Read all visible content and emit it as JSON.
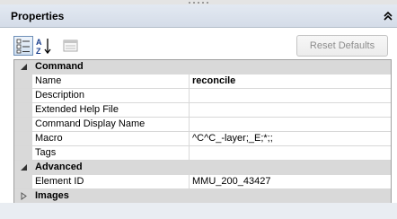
{
  "panel": {
    "title": "Properties"
  },
  "toolbar": {
    "reset_label": "Reset Defaults",
    "categorized_icon": "categorized-view-icon",
    "alphabetical_icon": "sort-az-icon",
    "pages_icon": "property-pages-icon"
  },
  "grid": {
    "categories": [
      {
        "label": "Command",
        "expanded": true,
        "rows": [
          {
            "name": "Name",
            "value": "reconcile",
            "bold": true
          },
          {
            "name": "Description",
            "value": ""
          },
          {
            "name": "Extended Help File",
            "value": ""
          },
          {
            "name": "Command Display Name",
            "value": ""
          },
          {
            "name": "Macro",
            "value": "^C^C_-layer;_E;*;;"
          },
          {
            "name": "Tags",
            "value": ""
          }
        ]
      },
      {
        "label": "Advanced",
        "expanded": true,
        "rows": [
          {
            "name": "Element ID",
            "value": "MMU_200_43427"
          }
        ]
      },
      {
        "label": "Images",
        "expanded": false,
        "rows": []
      }
    ]
  },
  "colors": {
    "title_bar": "#d9e0ea",
    "category_bg": "#d9d9d9",
    "grid_line": "#d8d8d8",
    "disabled_text": "#8d8d8d"
  }
}
